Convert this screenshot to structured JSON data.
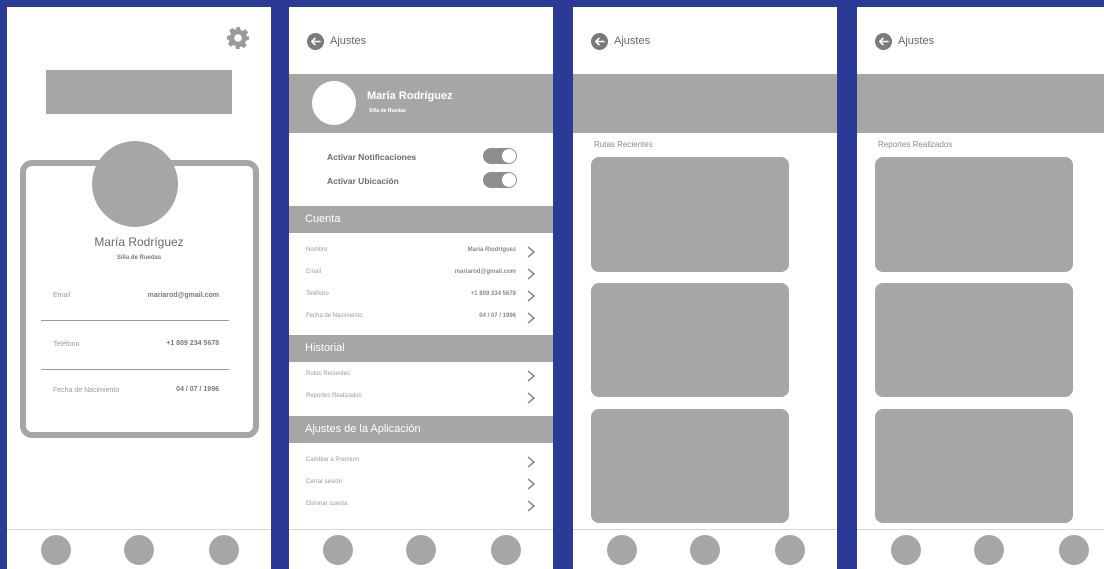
{
  "profile": {
    "name": "María Rodríguez",
    "subtitle": "Silla de Ruedas",
    "fields": [
      {
        "label": "Email",
        "value": "mariarod@gmail.com"
      },
      {
        "label": "Teléfono",
        "value": "+1 809 234 5678"
      },
      {
        "label": "Fecha de Nacimiento",
        "value": "04 / 07 / 1996"
      }
    ],
    "icons": {
      "settings": "gear-icon"
    }
  },
  "settings": {
    "title": "Ajustes",
    "user_name": "María Rodríguez",
    "user_subtitle": "Silla de Ruedas",
    "toggles": [
      {
        "label": "Activar Notificaciones",
        "on": true
      },
      {
        "label": "Activar Ubicación",
        "on": true
      }
    ],
    "cuenta_title": "Cuenta",
    "cuenta_rows": [
      {
        "label": "Nombre",
        "value": "María Riodríguez"
      },
      {
        "label": "Email",
        "value": "mariarod@gmail.com"
      },
      {
        "label": "Teléfono",
        "value": "+1 809 234 5678"
      },
      {
        "label": "Fecha de Nacimiento",
        "value": "04 / 07 / 1996"
      }
    ],
    "historial_title": "Historial",
    "historial_rows": [
      "Rutas Recientes",
      "Reportes Realizados"
    ],
    "app_title": "Ajustes de la Aplicación",
    "app_rows": [
      "Cambiar a Premium",
      "Cerrar sesión",
      "Eliminar cuenta"
    ]
  },
  "rutas": {
    "title": "Ajustes",
    "list_title": "Rutas Recientes"
  },
  "reportes": {
    "title": "Ajustes",
    "list_title": "Reportes Realizados"
  },
  "colors": {
    "background": "#2b3a94",
    "placeholder": "#a6a6a6",
    "surface": "#ffffff"
  }
}
